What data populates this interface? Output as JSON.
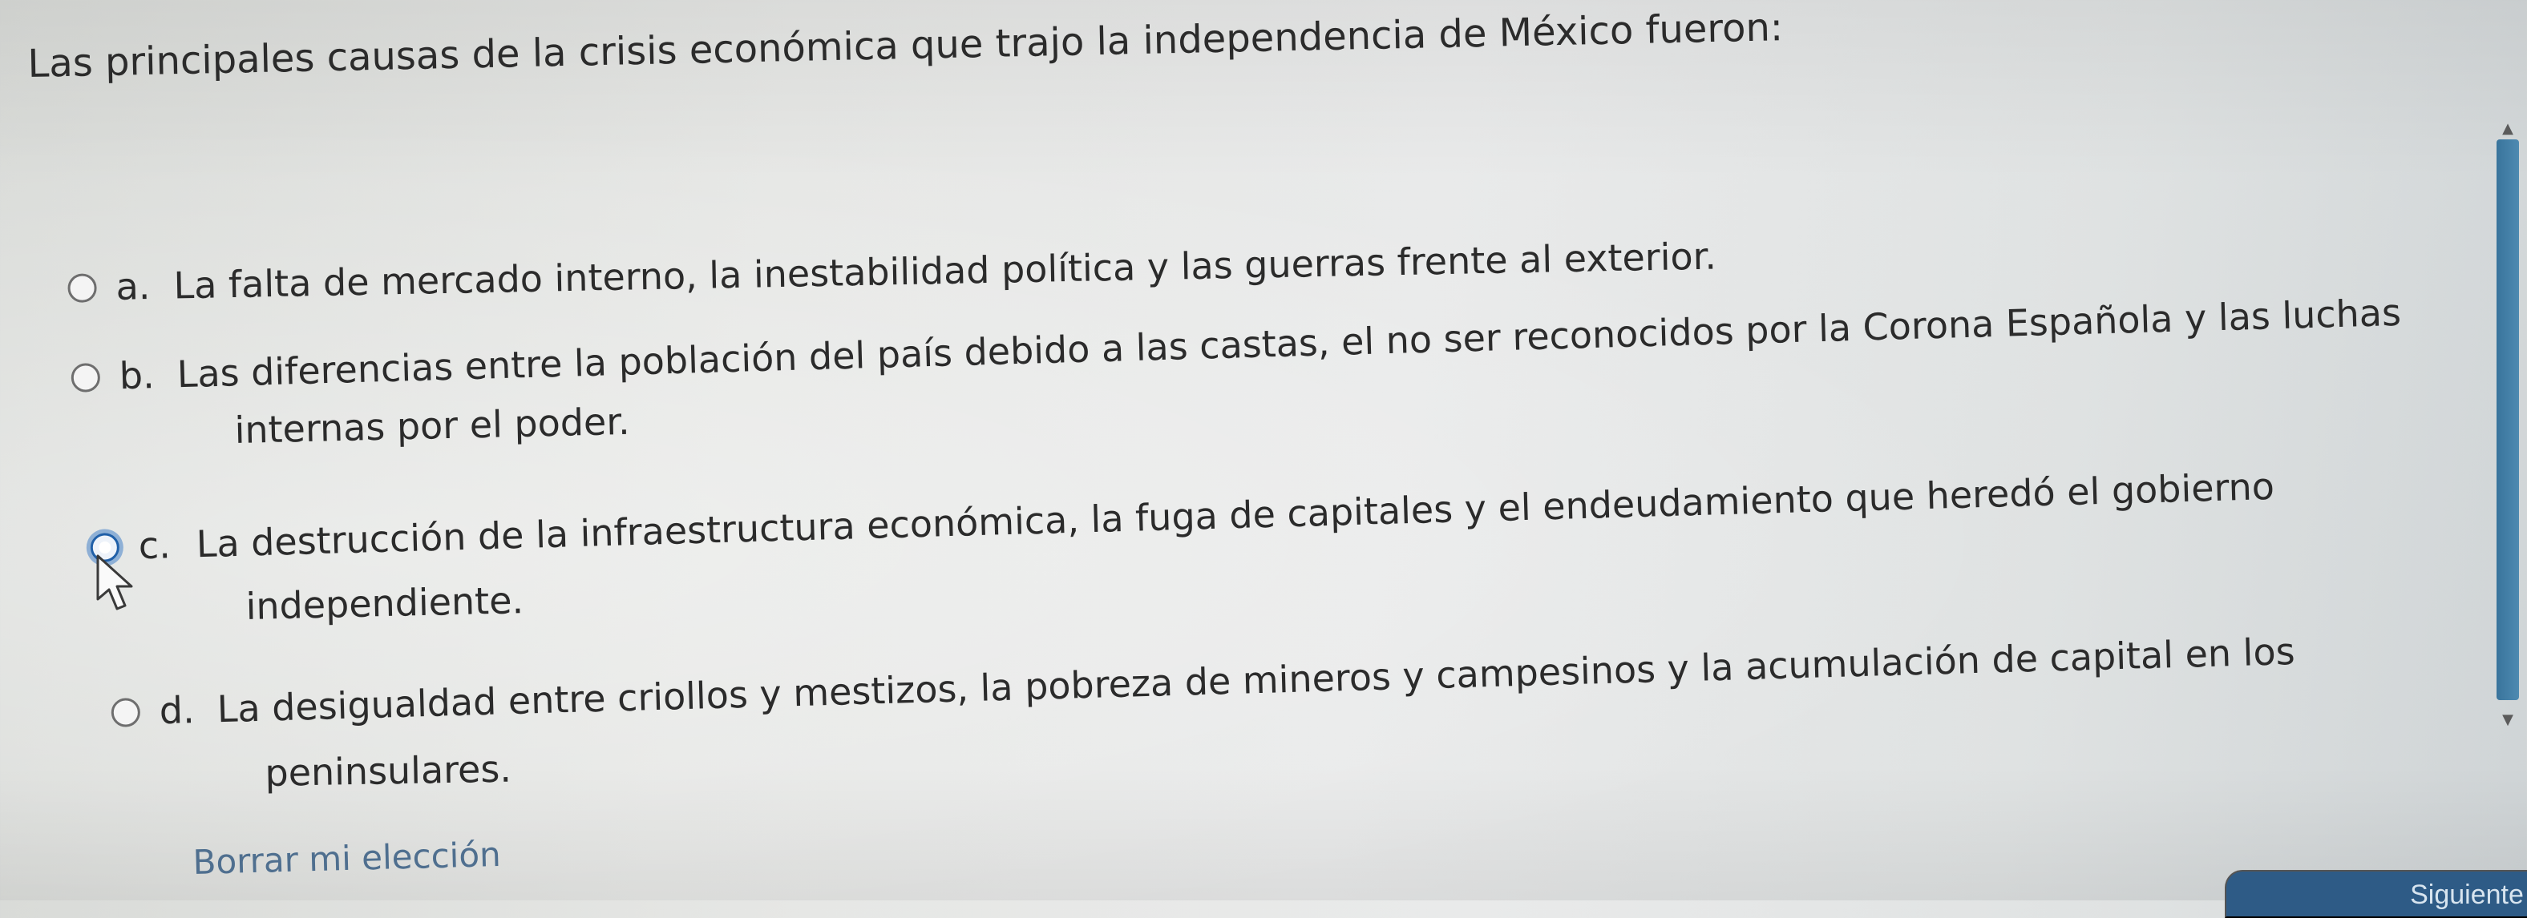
{
  "question": {
    "text": "Las principales causas de la crisis económica que trajo la independencia de México fueron:"
  },
  "options": [
    {
      "letter": "a.",
      "line1": "La falta de mercado interno, la inestabilidad política y las guerras frente al exterior.",
      "line2": ""
    },
    {
      "letter": "b.",
      "line1": "Las diferencias entre la población del país debido a las castas, el no ser reconocidos por la Corona Española y las luchas",
      "line2": "internas por el poder."
    },
    {
      "letter": "c.",
      "line1": "La destrucción de la infraestructura económica, la fuga de capitales y el endeudamiento que heredó el gobierno",
      "line2": "independiente."
    },
    {
      "letter": "d.",
      "line1": "La desigualdad entre criollos y mestizos, la pobreza de mineros y campesinos y la acumulación de capital en los",
      "line2": "peninsulares."
    }
  ],
  "clear_selection": {
    "label": "Borrar mi elección"
  },
  "next_button": {
    "label": "Siguiente"
  },
  "icons": {
    "cursor": "mouse-pointer-icon",
    "scroll_up": "chevron-up-icon",
    "scroll_down": "chevron-down-icon"
  },
  "colors": {
    "focus_ring": "#4682c8",
    "scrollbar": "#39749c",
    "next_button_bg": "#2e5b86",
    "link": "#4f6f8f"
  }
}
